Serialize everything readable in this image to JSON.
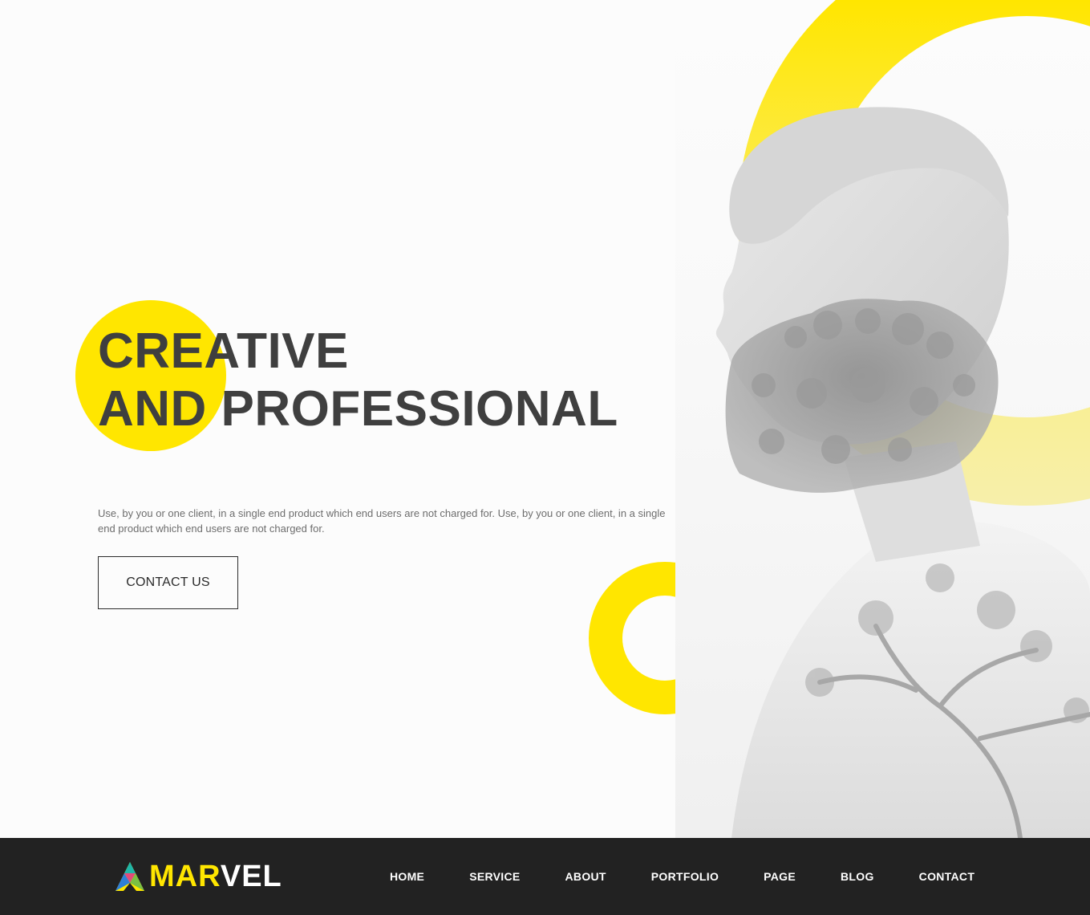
{
  "hero": {
    "headline_line1": "CREATIVE",
    "headline_line2": "AND PROFESSIONAL",
    "description": "Use, by you or one client, in a single end product which end users are not charged for. Use, by you or one client, in a single end product which end users are not charged for.",
    "cta_label": "CONTACT US"
  },
  "brand": {
    "name_part1": "MAR",
    "name_part2": "VEL",
    "icon": "marvel-logo-icon"
  },
  "nav": {
    "items": [
      "HOME",
      "SERVICE",
      "ABOUT",
      "PORTFOLIO",
      "PAGE",
      "BLOG",
      "CONTACT"
    ]
  },
  "colors": {
    "accent": "#ffe600",
    "text_dark": "#3f3f3f",
    "navbar_bg": "#222222"
  }
}
